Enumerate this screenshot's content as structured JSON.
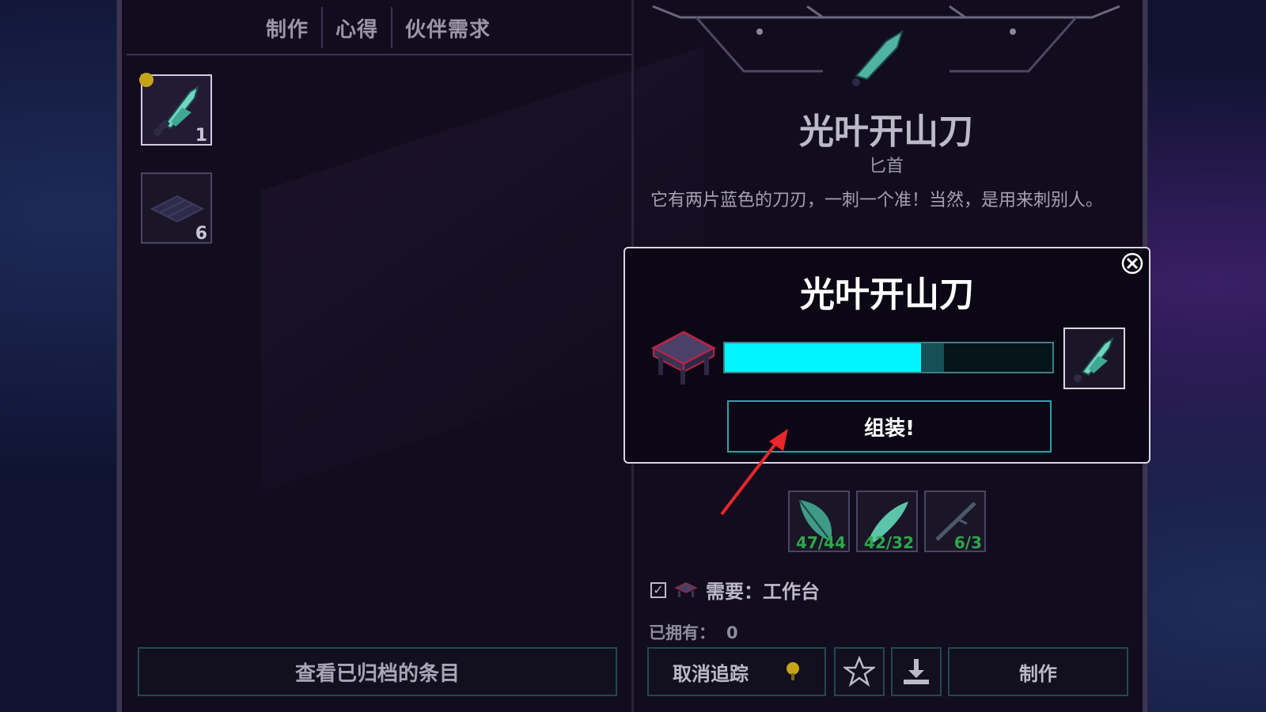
{
  "tabs": [
    {
      "label": "制作"
    },
    {
      "label": "心得"
    },
    {
      "label": "伙伴需求"
    }
  ],
  "left_slots": [
    {
      "icon": "sword-icon",
      "count": "1",
      "selected": true,
      "tracked": true
    },
    {
      "icon": "wood-plank-icon",
      "count": "6",
      "selected": false,
      "tracked": false
    }
  ],
  "archive_button": "查看已归档的条目",
  "item": {
    "name": "光叶开山刀",
    "type": "匕首",
    "description": "它有两片蓝色的刀刃，一刺一个准！当然，是用来刺别人。"
  },
  "materials": [
    {
      "icon": "leaf-icon",
      "count": "47/44"
    },
    {
      "icon": "blade-leaf-icon",
      "count": "42/32"
    },
    {
      "icon": "stick-icon",
      "count": "6/3"
    }
  ],
  "requirement": {
    "label": "需要：工作台",
    "checked": true,
    "icon": "workbench-icon"
  },
  "owned": {
    "label": "已拥有：",
    "value": "0"
  },
  "bottom_buttons": {
    "untrack": "取消追踪",
    "favorite_icon": "star-icon",
    "download_icon": "download-icon",
    "craft": "制作"
  },
  "popup": {
    "title": "光叶开山刀",
    "progress": 0.6,
    "progress_trail": 0.67,
    "assemble_label": "组装!",
    "station_icon": "workbench-icon",
    "result_icon": "sword-icon"
  },
  "colors": {
    "progress_fill": "#00f6ff",
    "button_border": "#2aa4ad",
    "check_green": "#2da84a",
    "annotation_arrow": "#e8262b"
  }
}
